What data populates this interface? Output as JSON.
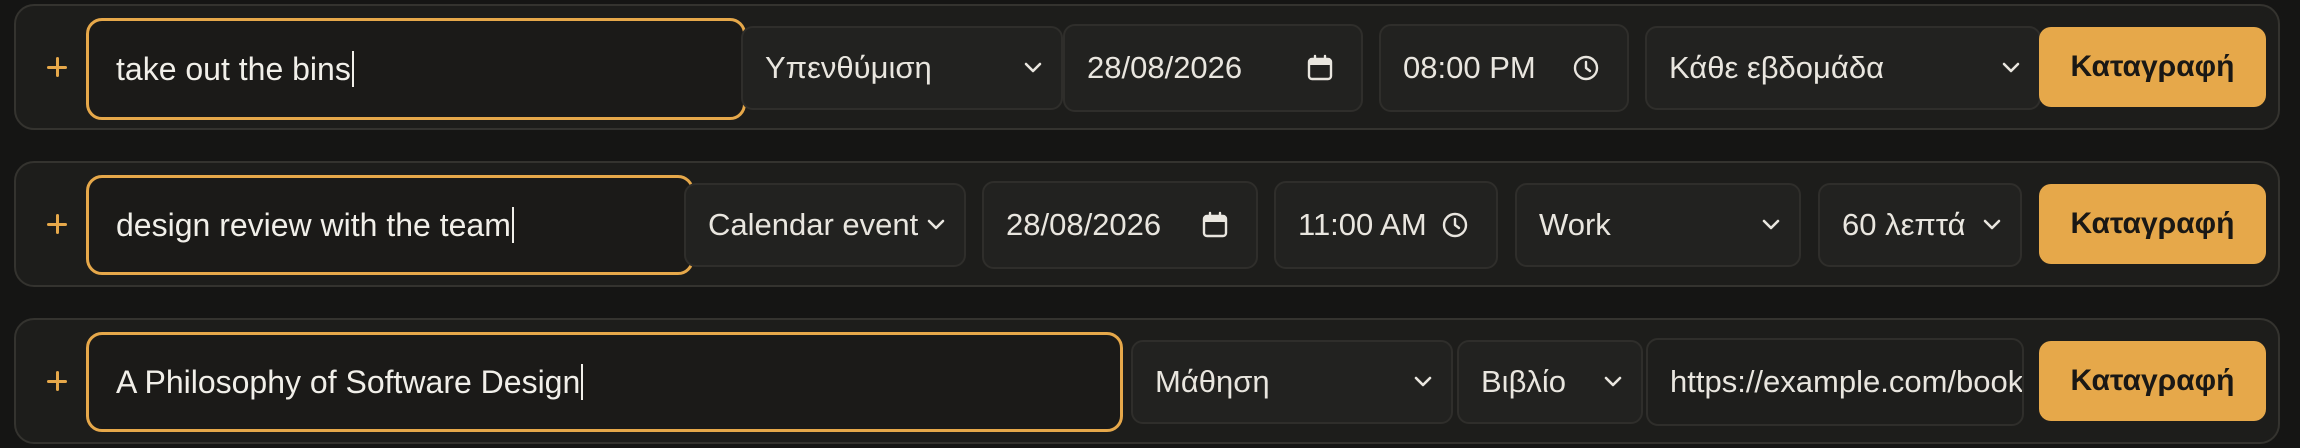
{
  "rows": [
    {
      "title_value": "take out the bins",
      "type_select": "Υπενθύμιση",
      "date_value": "28/08/2026",
      "time_value": "08:00 PM",
      "repeat_select": "Κάθε εβδομάδα",
      "submit_label": "Καταγραφή"
    },
    {
      "title_value": "design review with the team",
      "type_select": "Calendar event",
      "date_value": "28/08/2026",
      "time_value": "11:00 AM",
      "calendar_select": "Work",
      "duration_select": "60 λεπτά",
      "submit_label": "Καταγραφή"
    },
    {
      "title_value": "A Philosophy of Software Design",
      "category_select": "Μάθηση",
      "kind_select": "Βιβλίο",
      "url_value": "https://example.com/book",
      "submit_label": "Καταγραφή"
    }
  ],
  "colors": {
    "accent": "#e6a84a",
    "background": "#151514",
    "row_background": "#1d1d1b",
    "field_background": "#222220",
    "text": "#e9e6df"
  },
  "icons": {
    "add": "plus-icon",
    "dropdown": "chevron-down-icon",
    "date": "calendar-icon",
    "time": "clock-icon"
  }
}
